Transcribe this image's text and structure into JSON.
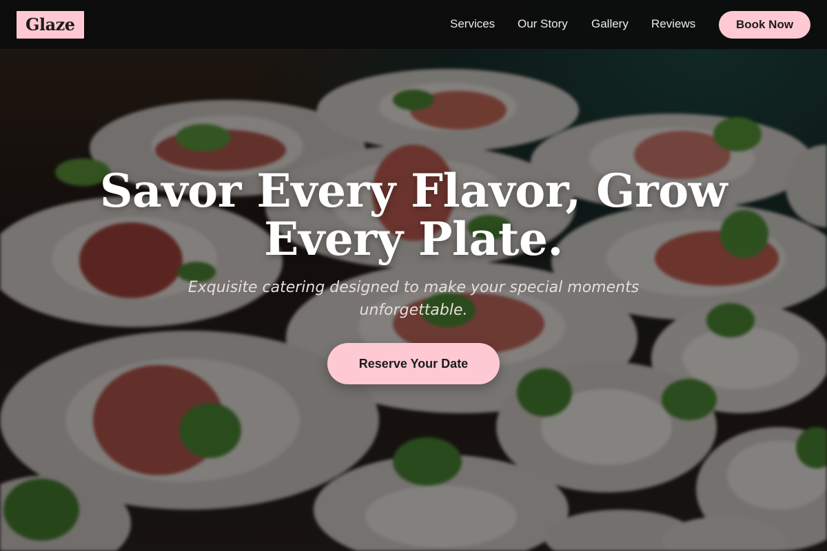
{
  "header": {
    "logo": "Glaze",
    "nav": [
      {
        "label": "Services"
      },
      {
        "label": "Our Story"
      },
      {
        "label": "Gallery"
      },
      {
        "label": "Reviews"
      }
    ],
    "book_label": "Book Now"
  },
  "hero": {
    "title_line1": "Savor Every Flavor, Grow",
    "title_line2": "Every Plate.",
    "subtitle": "Exquisite catering designed to make your special moments unforgettable.",
    "cta_label": "Reserve Your Date"
  },
  "colors": {
    "accent": "#ffc9d3",
    "header_bg": "#0c0c0c",
    "text_light": "#ffffff"
  }
}
